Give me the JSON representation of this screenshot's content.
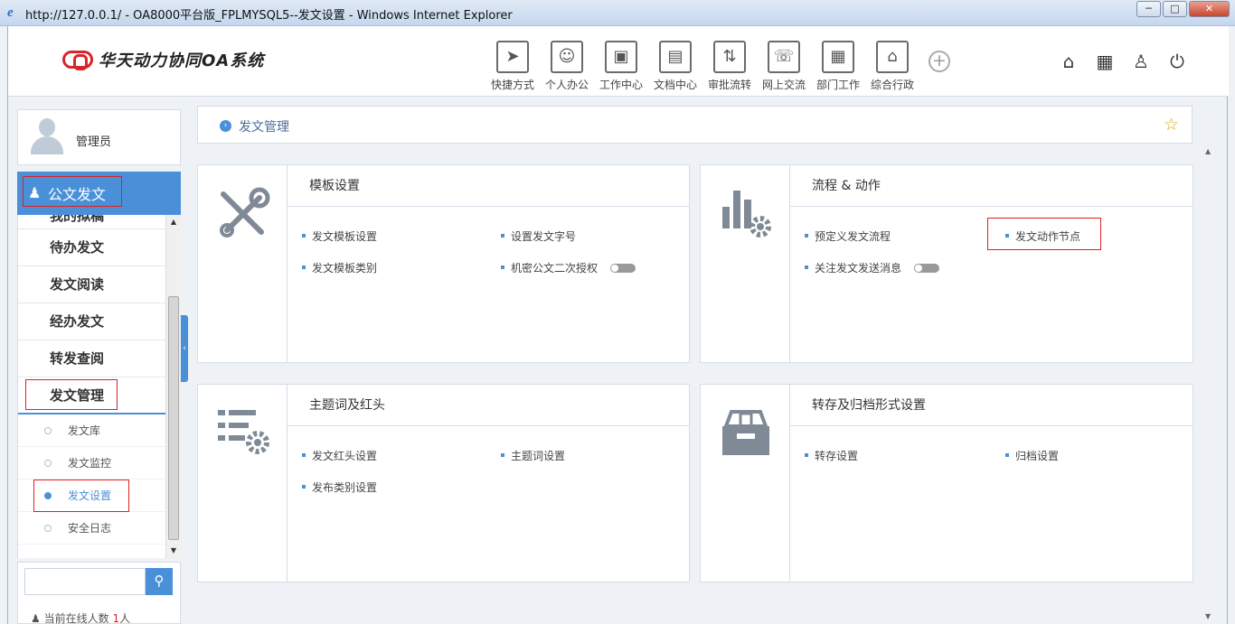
{
  "window": {
    "title": "http://127.0.0.1/ - OA8000平台版_FPLMYSQL5--发文设置 - Windows Internet Explorer",
    "buttons": {
      "minimize": "─",
      "maximize": "□",
      "close": "✕"
    }
  },
  "header": {
    "app_name": "华天动力协同OA系统",
    "nav": [
      {
        "label": "快捷方式",
        "icon": "send-icon",
        "glyph": "➤"
      },
      {
        "label": "个人办公",
        "icon": "person-icon",
        "glyph": "☺"
      },
      {
        "label": "工作中心",
        "icon": "briefcase-icon",
        "glyph": "▣"
      },
      {
        "label": "文档中心",
        "icon": "inbox-icon",
        "glyph": "▤"
      },
      {
        "label": "审批流转",
        "icon": "flow-icon",
        "glyph": "⇅"
      },
      {
        "label": "网上交流",
        "icon": "chat-icon",
        "glyph": "☏"
      },
      {
        "label": "部门工作",
        "icon": "dept-icon",
        "glyph": "▦"
      },
      {
        "label": "综合行政",
        "icon": "building-icon",
        "glyph": "⌂"
      }
    ],
    "more": "+",
    "right_icons": [
      {
        "name": "home-icon",
        "glyph": "⌂"
      },
      {
        "name": "grid-icon",
        "glyph": "▦"
      },
      {
        "name": "shirt-icon",
        "glyph": "♙"
      },
      {
        "name": "power-icon",
        "glyph": "⏻"
      }
    ]
  },
  "sidebar": {
    "user": "管理员",
    "section": "公文发文",
    "menu": [
      "我的拟稿",
      "待办发文",
      "发文阅读",
      "经办发文",
      "转发查阅",
      "发文管理"
    ],
    "sub_items": [
      "发文库",
      "发文监控",
      "发文设置",
      "安全日志"
    ],
    "selected_sub": "发文设置",
    "search_placeholder": "",
    "online_label": "当前在线人数",
    "online_count": "1",
    "online_unit": "人"
  },
  "breadcrumb": {
    "label": "发文管理"
  },
  "cards": {
    "template": {
      "title": "模板设置",
      "links": [
        "发文模板设置",
        "设置发文字号",
        "发文模板类别",
        "机密公文二次授权"
      ]
    },
    "flow": {
      "title": "流程 & 动作",
      "links": [
        "预定义发文流程",
        "发文动作节点",
        "关注发文发送消息"
      ]
    },
    "subject": {
      "title": "主题词及红头",
      "links": [
        "发文红头设置",
        "主题词设置",
        "发布类别设置"
      ]
    },
    "archive": {
      "title": "转存及归档形式设置",
      "links": [
        "转存设置",
        "归档设置"
      ]
    }
  },
  "colors": {
    "accent": "#4a90d9",
    "brand": "#d7252b",
    "highlight": "#e02020"
  }
}
